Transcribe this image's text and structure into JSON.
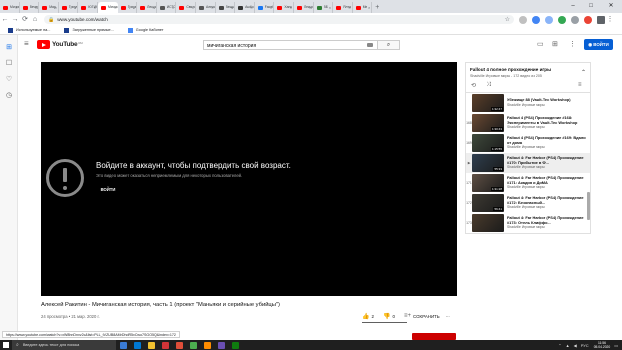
{
  "browser": {
    "tabs": [
      {
        "label": "Мичиганск",
        "icon_color": "#ff0000"
      },
      {
        "label": "Вечерний",
        "icon_color": "#ff0000"
      },
      {
        "label": "Мар. Ресто",
        "icon_color": "#ff0000"
      },
      {
        "label": "Триумф",
        "icon_color": "#ff0000"
      },
      {
        "label": "ЮГИН",
        "icon_color": "#ff0000"
      },
      {
        "label": "Мичиганск",
        "icon_color": "#ff0000"
      },
      {
        "label": "Триумф",
        "icon_color": "#ff0000"
      },
      {
        "label": "Лекция",
        "icon_color": "#ff0000"
      },
      {
        "label": "ИСТО",
        "icon_color": "#555555"
      },
      {
        "label": "Святос",
        "icon_color": "#ff0000"
      },
      {
        "label": "Алекс",
        "icon_color": "#555555"
      },
      {
        "label": "Вещь",
        "icon_color": "#444444"
      },
      {
        "label": "Audio",
        "icon_color": "#333333"
      },
      {
        "label": "Facebook",
        "icon_color": "#1877f2"
      },
      {
        "label": "Ханс",
        "icon_color": "#ff0000"
      },
      {
        "label": "Лекци",
        "icon_color": "#ff0000"
      },
      {
        "label": "ВБ",
        "icon_color": "#2e7d32"
      },
      {
        "label": "Ялта",
        "icon_color": "#ff0000"
      },
      {
        "label": "Ме",
        "icon_color": "#ff0000"
      }
    ],
    "active_tab_index": 5,
    "new_tab_label": "+",
    "window_controls": {
      "minimize": "–",
      "maximize": "□",
      "close": "✕"
    },
    "address": "www.youtube.com/watch",
    "bookmarks": [
      {
        "label": "Используемые на...",
        "icon_color": "#1a3c8c"
      },
      {
        "label": "Загруженные прямые...",
        "icon_color": "#1a3c8c"
      },
      {
        "label": "Google Кабинет",
        "icon_color": "#4285f4"
      }
    ]
  },
  "youtube": {
    "logo_text": "YouTube",
    "logo_sup": "RU",
    "search_query": "мичиганская история",
    "signin_label": "ВОЙТИ"
  },
  "player": {
    "age_title": "Войдите в аккаунт, чтобы подтвердить свой возраст.",
    "age_subtitle": "Это видео может оказаться неприемлемым для некоторых пользователей.",
    "signin_label": "ВОЙТИ"
  },
  "video": {
    "title": "Алексей Ракитин - Мичиганская история, часть 1 (проект \"Маньяки и серийные убийцы\")",
    "meta": "24 просмотра • 21 мар. 2020 г.",
    "likes": "2",
    "dislikes": "0",
    "like_ratio": 1.0,
    "share_label": "",
    "save_label": "СОХРАНИТЬ",
    "more_label": "..."
  },
  "playlist": {
    "title": "Fallout 4 полное прохождение игры",
    "subtitle": "Shadville  Игровые миры - 172 видео из 205",
    "items": [
      {
        "index": "",
        "title": "Убежище 88 (Vault-Tec Workshop)",
        "channel": "Shadville  Игровые миры",
        "duration": "1:32:47",
        "thumb": "#5b3f2a",
        "selected": false
      },
      {
        "index": "168",
        "title": "Fallout 4 (PS4) Прохождение #168: Эксперименты в Vault-Tec Workshop",
        "channel": "Shadville  Игровые миры",
        "duration": "1:30:43",
        "thumb": "#6b4a33",
        "selected": false
      },
      {
        "index": "169",
        "title": "Fallout 4 (PS4) Прохождение #169: Вдали от дома",
        "channel": "Shadville  Игровые миры",
        "duration": "1:15:55",
        "thumb": "#3f4a3c",
        "selected": false
      },
      {
        "index": "▶",
        "title": "Fallout 4: Far Harbor (PS4) Прохождение #170: Прибытие в Ф...",
        "channel": "Shadville  Игровые миры",
        "duration": "55:33",
        "thumb": "#2f3f4f",
        "selected": true
      },
      {
        "index": "171",
        "title": "Fallout 4: Far Harbor (PS4) Прохождение #171: Акадия и ДиМА",
        "channel": "Shadville  Игровые миры",
        "duration": "1:31:28",
        "thumb": "#5f5045",
        "selected": false
      },
      {
        "index": "172",
        "title": "Fallout 4: Far Harbor (PS4) Прохождение #172: Безопасный...",
        "channel": "Shadville  Игровые миры",
        "duration": "56:41",
        "thumb": "#3d3a33",
        "selected": false
      },
      {
        "index": "173",
        "title": "Fallout 4: Far Harbor (PS4) Прохождение #173: Отель Клиффо...",
        "channel": "Shadville  Игровые миры",
        "duration": "",
        "thumb": "#4a3b2c",
        "selected": false
      }
    ]
  },
  "status_url": "https://www.youtube.com/watch?v=xW8hnDnxv2c&list=PLL_tVZUB8AMrDhdR5xCwo7SGO5Q&index=172",
  "taskbar": {
    "search_placeholder": "Введите здесь текст для поиска",
    "apps": [
      "#3a7bd5",
      "#0078d4",
      "#f0c030",
      "#d13438",
      "#e04e39",
      "#4caf50",
      "#ff8c00",
      "#6a4fb3",
      "#0f7b0f"
    ],
    "language": "РУС",
    "time": "11:56",
    "date": "05.04.2020"
  }
}
